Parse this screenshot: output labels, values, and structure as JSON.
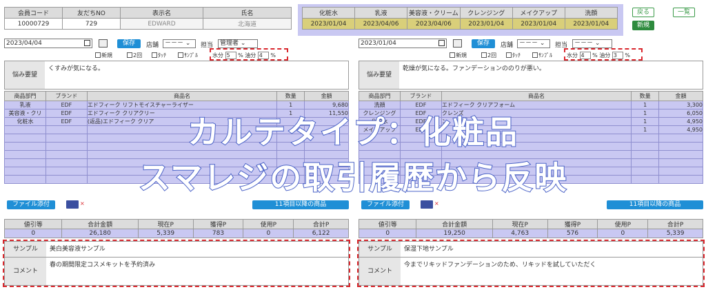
{
  "member": {
    "headers": [
      "会員コード",
      "友だちNO",
      "表示名",
      "氏名"
    ],
    "values": [
      "10000729",
      "729",
      "EDWARD",
      "北海道"
    ]
  },
  "cosmetics": {
    "headers": [
      "化粧水",
      "乳液",
      "美容液・クリーム",
      "クレンジング",
      "メイクアップ",
      "洗顔"
    ],
    "values": [
      "2023/01/04",
      "2023/04/06",
      "2023/04/06",
      "2023/01/04",
      "2023/01/04",
      "2023/01/04"
    ]
  },
  "nav": {
    "back": "戻る",
    "list": "一覧",
    "new": "新規"
  },
  "left": {
    "date": "2023/04/04",
    "save": "保存",
    "store_label": "店舗",
    "store_value": "－－－",
    "staff_label": "担当",
    "staff_value": "管理者",
    "checks": [
      "新規",
      "2回",
      "ﾀｯﾁ",
      "ｻﾝﾌﾟﾙ"
    ],
    "moisture_label": "水分",
    "moisture": "5",
    "pct": "%",
    "oil_label": "油分",
    "oil": "4",
    "concern_label": "悩み要望",
    "concern": "くすみが気になる。",
    "item_headers": [
      "商品部門",
      "ブランド",
      "商品名",
      "数量",
      "金額"
    ],
    "items": [
      [
        "乳液",
        "EDF",
        "エドフィーク リフトモイスチャーライザー",
        "1",
        "9,680"
      ],
      [
        "美容液・クリ",
        "EDF",
        "エドフィーク クリアクリー",
        "1",
        "11,550"
      ],
      [
        "化粧水",
        "EDF",
        "(返品)エドフィーク クリア",
        "",
        ""
      ],
      [
        "",
        "",
        "",
        "",
        ""
      ],
      [
        "",
        "",
        "",
        "",
        ""
      ],
      [
        "",
        "",
        "",
        "",
        ""
      ],
      [
        "",
        "",
        "",
        "",
        ""
      ],
      [
        "",
        "",
        "",
        "",
        ""
      ],
      [
        "",
        "",
        "",
        "",
        ""
      ],
      [
        "",
        "",
        "",
        "",
        ""
      ]
    ],
    "file_add": "ファイル添付",
    "img_x": "×",
    "more": "11項目以降の商品",
    "total_headers": [
      "値引等",
      "合計金額",
      "現在P",
      "獲得P",
      "使用P",
      "合計P"
    ],
    "totals": [
      "0",
      "26,180",
      "5,339",
      "783",
      "0",
      "6,122"
    ],
    "sample_label": "サンプル",
    "sample": "美白美容液サンプル",
    "comment_label": "コメント",
    "comment": "春の期間限定コスメキットを予約済み"
  },
  "right": {
    "date": "2023/01/04",
    "save": "保存",
    "store_label": "店舗",
    "store_value": "－－－",
    "staff_label": "担当",
    "staff_value": "－－－",
    "checks": [
      "新規",
      "2回",
      "ﾀｯﾁ",
      "ｻﾝﾌﾟﾙ"
    ],
    "moisture_label": "水分",
    "moisture": "4",
    "pct": "%",
    "oil_label": "油分",
    "oil": "3",
    "concern_label": "悩み要望",
    "concern": "乾燥が気になる。ファンデーションののりが悪い。",
    "item_headers": [
      "商品部門",
      "ブランド",
      "商品名",
      "数量",
      "金額"
    ],
    "items": [
      [
        "洗顔",
        "EDF",
        "エドフィーク クリアフォーム",
        "1",
        "3,300"
      ],
      [
        "クレンジング",
        "EDF",
        "クレンズ",
        "1",
        "6,050"
      ],
      [
        "化粧水",
        "EDF",
        "ン",
        "1",
        "4,950"
      ],
      [
        "メイクアップ",
        "EDF",
        "",
        "1",
        "4,950"
      ],
      [
        "",
        "",
        "",
        "",
        ""
      ],
      [
        "",
        "",
        "",
        "",
        ""
      ],
      [
        "",
        "",
        "",
        "",
        ""
      ],
      [
        "",
        "",
        "",
        "",
        ""
      ],
      [
        "",
        "",
        "",
        "",
        ""
      ],
      [
        "",
        "",
        "",
        "",
        ""
      ]
    ],
    "file_add": "ファイル添付",
    "img_x": "×",
    "more": "11項目以降の商品",
    "total_headers": [
      "値引等",
      "合計金額",
      "現在P",
      "獲得P",
      "使用P",
      "合計P"
    ],
    "totals": [
      "0",
      "19,250",
      "4,763",
      "576",
      "0",
      "5,339"
    ],
    "sample_label": "サンプル",
    "sample": "保湿下地サンプル",
    "comment_label": "コメント",
    "comment": "今までリキッドファンデーションのため、リキッドを試していただく"
  },
  "overlay": {
    "line1": "カルテタイプ：化粧品",
    "line2": "スマレジの取引履歴から反映"
  },
  "colors": {
    "accent_blue": "#1f8fd6",
    "highlight": "#c9c8f2",
    "date_gold": "#d9cf7a",
    "red_dash": "#d9262c",
    "green": "#2e8b3e"
  }
}
